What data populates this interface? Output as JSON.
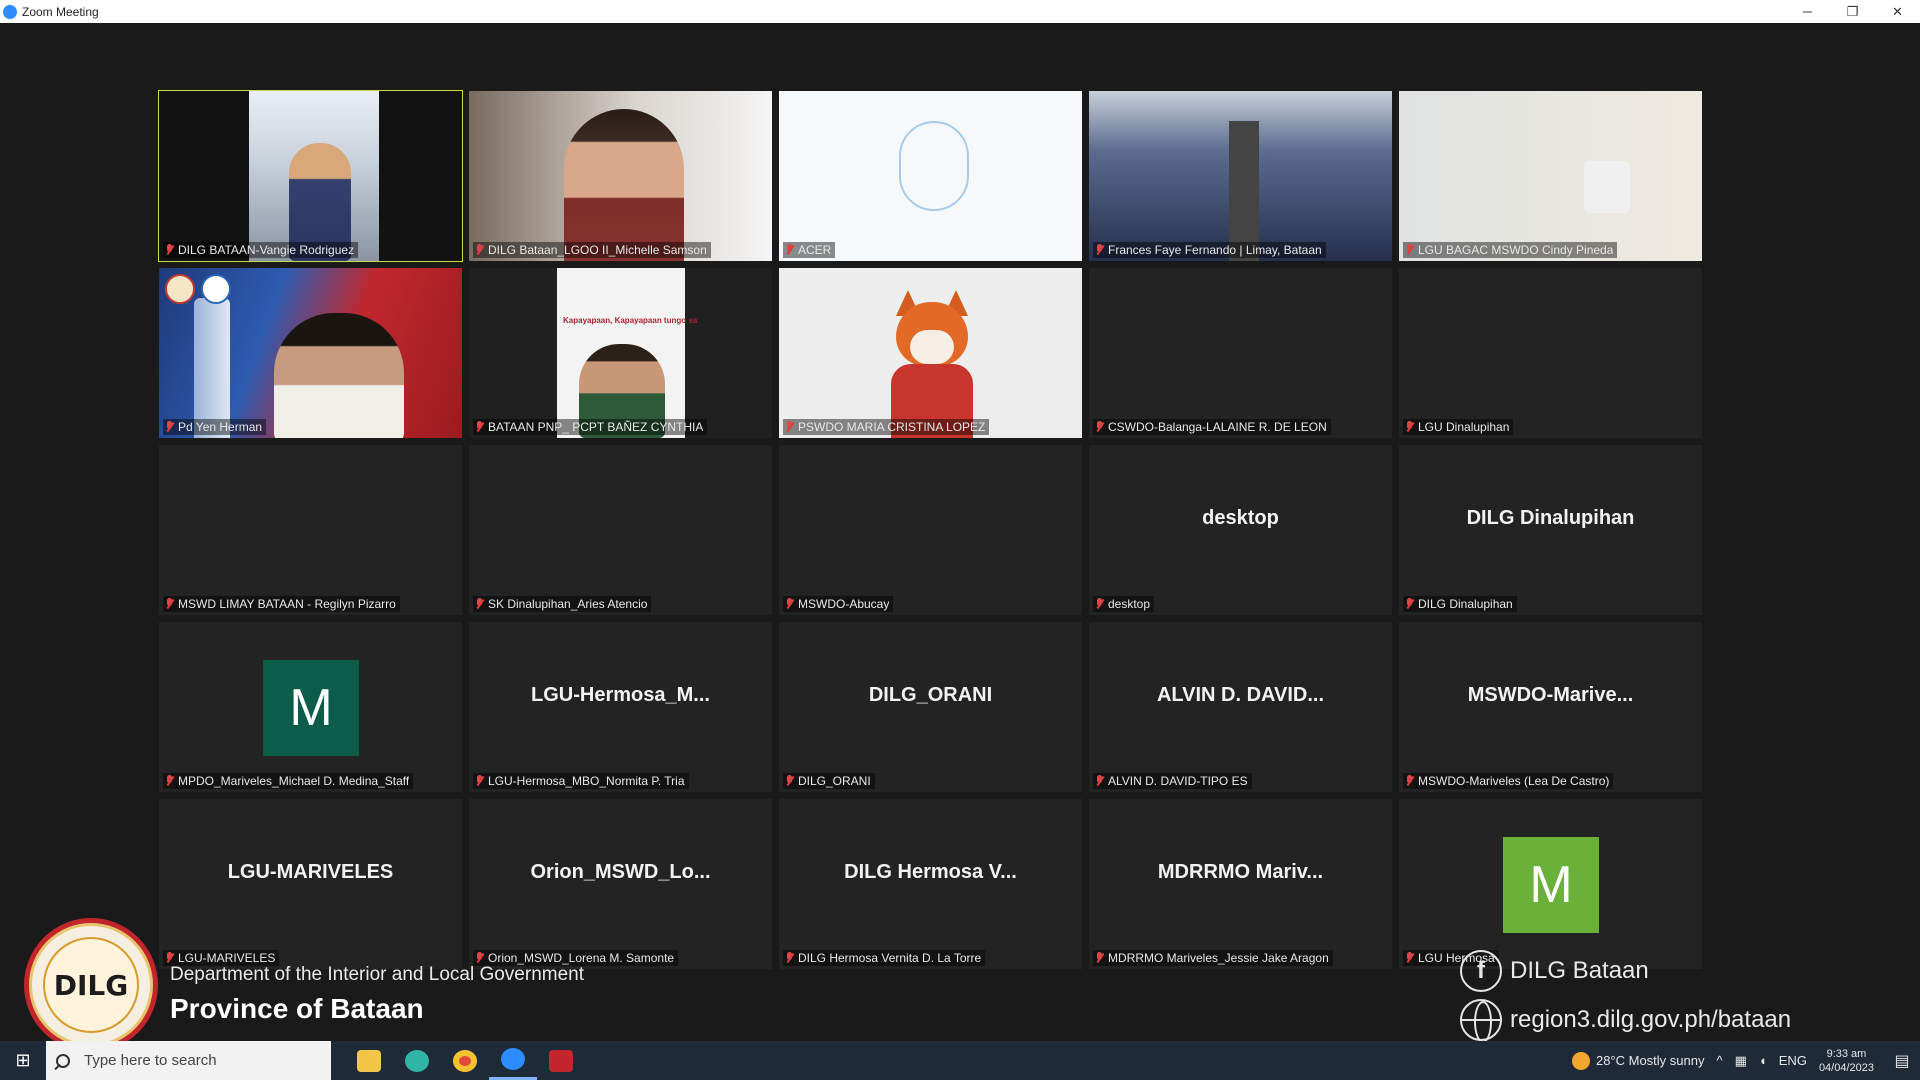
{
  "window": {
    "title": "Zoom Meeting"
  },
  "window_controls": {
    "minimize": "─",
    "restore": "❐",
    "close": "✕"
  },
  "tiles": [
    {
      "label": "DILG BATAAN-Vangie Rodriguez",
      "center": ""
    },
    {
      "label": "DILG Bataan_LGOO II_Michelle Samson",
      "center": ""
    },
    {
      "label": "ACER",
      "center": ""
    },
    {
      "label": "Frances Faye Fernando | Limay, Bataan",
      "center": ""
    },
    {
      "label": "LGU BAGAC MSWDO Cindy Pineda",
      "center": ""
    },
    {
      "label": "Pd Yen Herman",
      "center": ""
    },
    {
      "label": "BATAAN PNP_ PCPT BAÑEZ CYNTHIA",
      "center": "",
      "poster_text": "Kapayapaan, Kapayapaan tungo sa"
    },
    {
      "label": "PSWDO MARIA CRISTINA LOPEZ",
      "center": ""
    },
    {
      "label": "CSWDO-Balanga-LALAINE R. DE LEON",
      "center": ""
    },
    {
      "label": "LGU Dinalupihan",
      "center": ""
    },
    {
      "label": "MSWD LIMAY BATAAN - Regilyn Pizarro",
      "center": ""
    },
    {
      "label": "SK Dinalupihan_Aries Atencio",
      "center": ""
    },
    {
      "label": "MSWDO-Abucay",
      "center": ""
    },
    {
      "label": "desktop",
      "center": "desktop"
    },
    {
      "label": "DILG Dinalupihan",
      "center": "DILG Dinalupihan"
    },
    {
      "label": "MPDO_Mariveles_Michael D. Medina_Staff",
      "center": "",
      "avatar": "M"
    },
    {
      "label": "LGU-Hermosa_MBO_Normita P. Tria",
      "center": "LGU-Hermosa_M..."
    },
    {
      "label": "DILG_ORANI",
      "center": "DILG_ORANI"
    },
    {
      "label": "ALVIN D. DAVID-TIPO ES",
      "center": "ALVIN D. DAVID..."
    },
    {
      "label": "MSWDO-Mariveles (Lea De Castro)",
      "center": "MSWDO-Marive..."
    },
    {
      "label": "LGU-MARIVELES",
      "center": "LGU-MARIVELES"
    },
    {
      "label": "Orion_MSWD_Lorena M. Samonte",
      "center": "Orion_MSWD_Lo..."
    },
    {
      "label": "DILG Hermosa Vernita D. La Torre",
      "center": "DILG Hermosa V..."
    },
    {
      "label": "MDRRMO Mariveles_Jessie Jake Aragon",
      "center": "MDRRMO Mariv..."
    },
    {
      "label": "LGU Hermosa",
      "center": "",
      "avatar": "M"
    }
  ],
  "branding": {
    "logo_text": "DILG",
    "department": "Department of the Interior and Local Government",
    "province": "Province of Bataan",
    "facebook_icon": "f",
    "facebook": "DILG Bataan",
    "website": "region3.dilg.gov.ph/bataan"
  },
  "taskbar": {
    "start_icon": "⊞",
    "search_placeholder": "Type here to search",
    "weather": "28°C  Mostly sunny",
    "tray_chevron": "^",
    "language": "ENG",
    "time": "9:33 am",
    "date": "04/04/2023",
    "notification_icon": "▤"
  },
  "colors": {
    "active_speaker": "#c9d94a",
    "avatar_teal": "#0c5c4a",
    "avatar_green": "#6ab13a",
    "tile_bg": "#232323",
    "taskbar_bg": "#1f2a38"
  }
}
